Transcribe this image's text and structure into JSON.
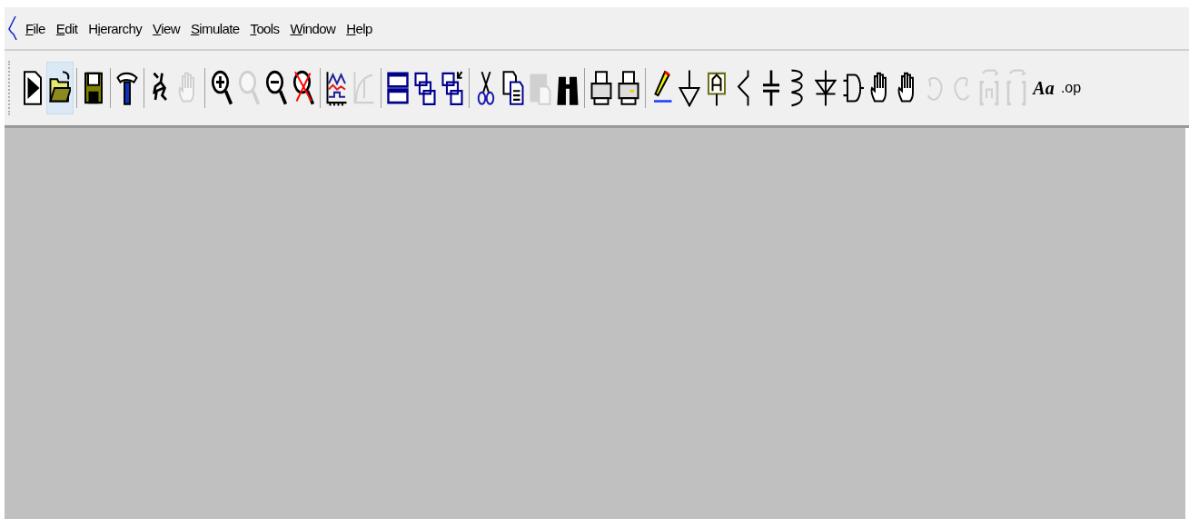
{
  "menu": [
    {
      "key": "F",
      "post": "ile"
    },
    {
      "key": "E",
      "post": "dit"
    },
    {
      "pre": "H",
      "key": "i",
      "post": "erarchy"
    },
    {
      "key": "V",
      "post": "iew"
    },
    {
      "key": "S",
      "post": "imulate"
    },
    {
      "key": "T",
      "post": "ools"
    },
    {
      "key": "W",
      "post": "indow"
    },
    {
      "key": "H",
      "post": "elp"
    }
  ],
  "toolbar": [
    {
      "kind": "new",
      "disabled": false,
      "selected": false
    },
    {
      "kind": "open",
      "disabled": false,
      "selected": true
    },
    {
      "kind": "separator"
    },
    {
      "kind": "save",
      "disabled": false,
      "selected": false
    },
    {
      "kind": "separator"
    },
    {
      "kind": "hammer",
      "disabled": false,
      "selected": false
    },
    {
      "kind": "separator"
    },
    {
      "kind": "run",
      "disabled": false,
      "selected": false
    },
    {
      "kind": "halt",
      "disabled": true,
      "selected": false
    },
    {
      "kind": "separator"
    },
    {
      "kind": "zoom-in",
      "disabled": false,
      "selected": false
    },
    {
      "kind": "zoom",
      "disabled": true,
      "selected": false
    },
    {
      "kind": "zoom-out",
      "disabled": false,
      "selected": false
    },
    {
      "kind": "zoom-fit",
      "disabled": false,
      "selected": false
    },
    {
      "kind": "separator"
    },
    {
      "kind": "waveform",
      "disabled": false,
      "selected": false
    },
    {
      "kind": "dial",
      "disabled": true,
      "selected": false
    },
    {
      "kind": "separator"
    },
    {
      "kind": "tile",
      "disabled": false,
      "selected": false
    },
    {
      "kind": "cascade",
      "disabled": false,
      "selected": false
    },
    {
      "kind": "cascade-arrow",
      "disabled": false,
      "selected": false
    },
    {
      "kind": "separator"
    },
    {
      "kind": "cut",
      "disabled": false,
      "selected": false
    },
    {
      "kind": "copy",
      "disabled": false,
      "selected": false
    },
    {
      "kind": "paste",
      "disabled": true,
      "selected": false
    },
    {
      "kind": "find",
      "disabled": false,
      "selected": false
    },
    {
      "kind": "separator"
    },
    {
      "kind": "print-preview",
      "disabled": false,
      "selected": false
    },
    {
      "kind": "print",
      "disabled": false,
      "selected": false
    },
    {
      "kind": "separator"
    },
    {
      "kind": "wire",
      "disabled": false,
      "selected": false
    },
    {
      "kind": "ground",
      "disabled": false,
      "selected": false
    },
    {
      "kind": "label",
      "disabled": false,
      "selected": false
    },
    {
      "kind": "resistor",
      "disabled": false,
      "selected": false
    },
    {
      "kind": "capacitor",
      "disabled": false,
      "selected": false
    },
    {
      "kind": "inductor",
      "disabled": false,
      "selected": false
    },
    {
      "kind": "diode",
      "disabled": false,
      "selected": false
    },
    {
      "kind": "component",
      "disabled": false,
      "selected": false
    },
    {
      "kind": "move",
      "disabled": false,
      "selected": false
    },
    {
      "kind": "drag",
      "disabled": false,
      "selected": false
    },
    {
      "kind": "undo",
      "disabled": true,
      "selected": false
    },
    {
      "kind": "redo",
      "disabled": true,
      "selected": false
    },
    {
      "kind": "rotate",
      "disabled": true,
      "selected": false
    },
    {
      "kind": "mirror",
      "disabled": true,
      "selected": false
    },
    {
      "kind": "text",
      "text": "Aa",
      "disabled": false,
      "selected": false
    },
    {
      "kind": "directive",
      "text": ".op",
      "disabled": false,
      "selected": false
    }
  ]
}
